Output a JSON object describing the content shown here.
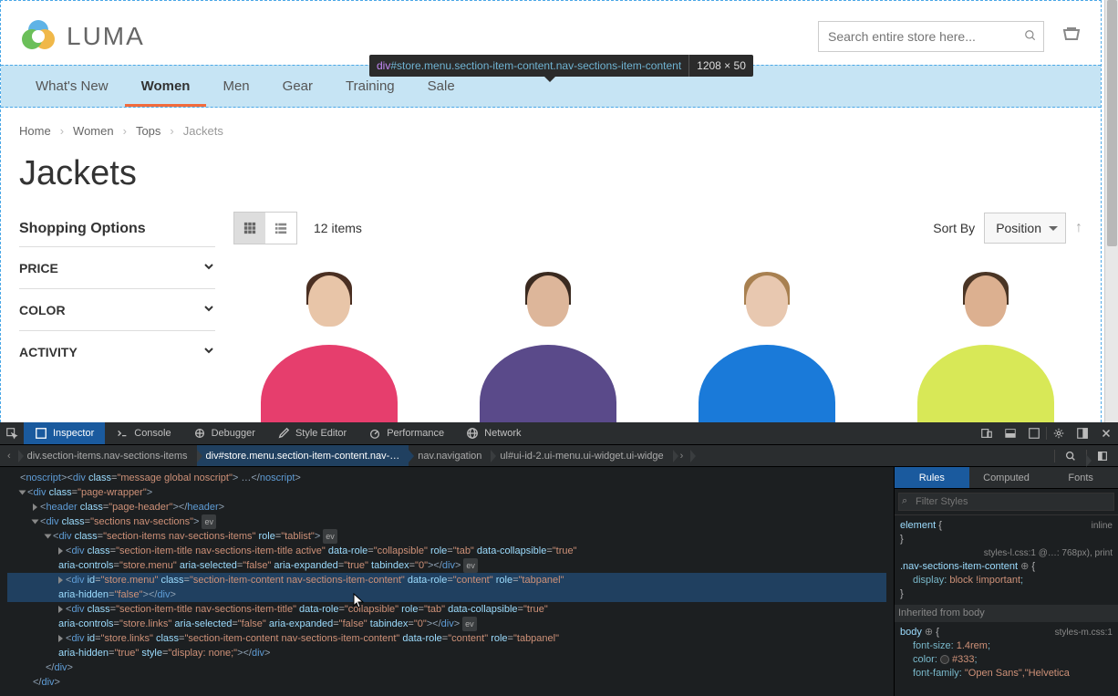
{
  "logo_text": "LUMA",
  "search_placeholder": "Search entire store here...",
  "nav": [
    {
      "label": "What's New",
      "active": false
    },
    {
      "label": "Women",
      "active": true
    },
    {
      "label": "Men",
      "active": false
    },
    {
      "label": "Gear",
      "active": false
    },
    {
      "label": "Training",
      "active": false
    },
    {
      "label": "Sale",
      "active": false
    }
  ],
  "tooltip_selector_tag": "div",
  "tooltip_selector_id": "#store.menu",
  "tooltip_selector_cls": ".section-item-content.nav-sections-item-content",
  "tooltip_dims": "1208 × 50",
  "breadcrumbs": [
    "Home",
    "Women",
    "Tops",
    "Jackets"
  ],
  "page_title": "Jackets",
  "shopping_options": "Shopping Options",
  "filters": [
    "PRICE",
    "COLOR",
    "ACTIVITY"
  ],
  "item_count": "12 items",
  "sort_by": "Sort By",
  "sort_value": "Position",
  "devtools": {
    "tabs": [
      "Inspector",
      "Console",
      "Debugger",
      "Style Editor",
      "Performance",
      "Network"
    ],
    "breadcrumb": [
      "div.section-items.nav-sections-items",
      "div#store.menu.section-item-content.nav-…",
      "nav.navigation",
      "ul#ui-id-2.ui-menu.ui-widget.ui-widge"
    ],
    "styles_tabs": [
      "Rules",
      "Computed",
      "Fonts"
    ],
    "filter_placeholder": "Filter Styles",
    "rules": {
      "element": "element",
      "inline": "inline",
      "src1": "styles-l.css:1 @…: 768px), print",
      "sel1": ".nav-sections-item-content",
      "prop1": "display",
      "val1": "block !important",
      "inh": "Inherited from body",
      "src2": "styles-m.css:1",
      "sel2": "body",
      "p2": "font-size",
      "v2": "1.4rem",
      "p3": "color",
      "v3": "#333",
      "p4": "font-family",
      "v4": "\"Open Sans\",\"Helvetica"
    }
  }
}
